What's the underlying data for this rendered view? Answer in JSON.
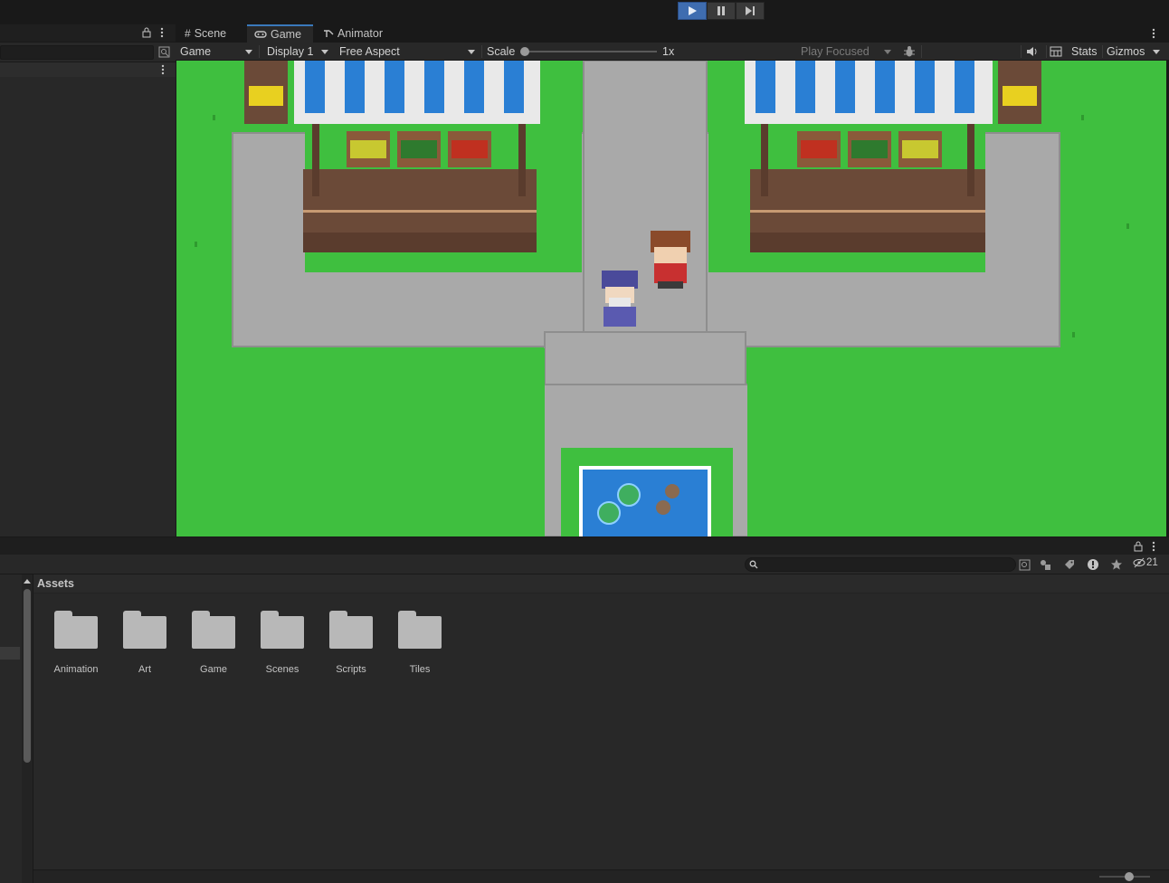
{
  "toolbar": {
    "play_icon": "play-icon",
    "pause_icon": "pause-icon",
    "step_icon": "step-icon"
  },
  "tabs": [
    {
      "label": "Scene",
      "icon": "grid-icon"
    },
    {
      "label": "Game",
      "icon": "gamepad-icon",
      "active": true
    },
    {
      "label": "Animator",
      "icon": "animator-icon"
    }
  ],
  "game_toolbar": {
    "view_mode": "Game",
    "display": "Display 1",
    "aspect": "Free Aspect",
    "scale_label": "Scale",
    "scale_value": "1x",
    "play_mode": "Play Focused",
    "stats_label": "Stats",
    "gizmos_label": "Gizmos"
  },
  "project": {
    "breadcrumb": "Assets",
    "hidden_count": "21",
    "folders": [
      "Animation",
      "Art",
      "Game",
      "Scenes",
      "Scripts",
      "Tiles"
    ]
  },
  "colors": {
    "accent": "#3f6db0",
    "grass": "#3fbf3f",
    "path": "#a8a8a8",
    "water": "#2a7fd4"
  }
}
